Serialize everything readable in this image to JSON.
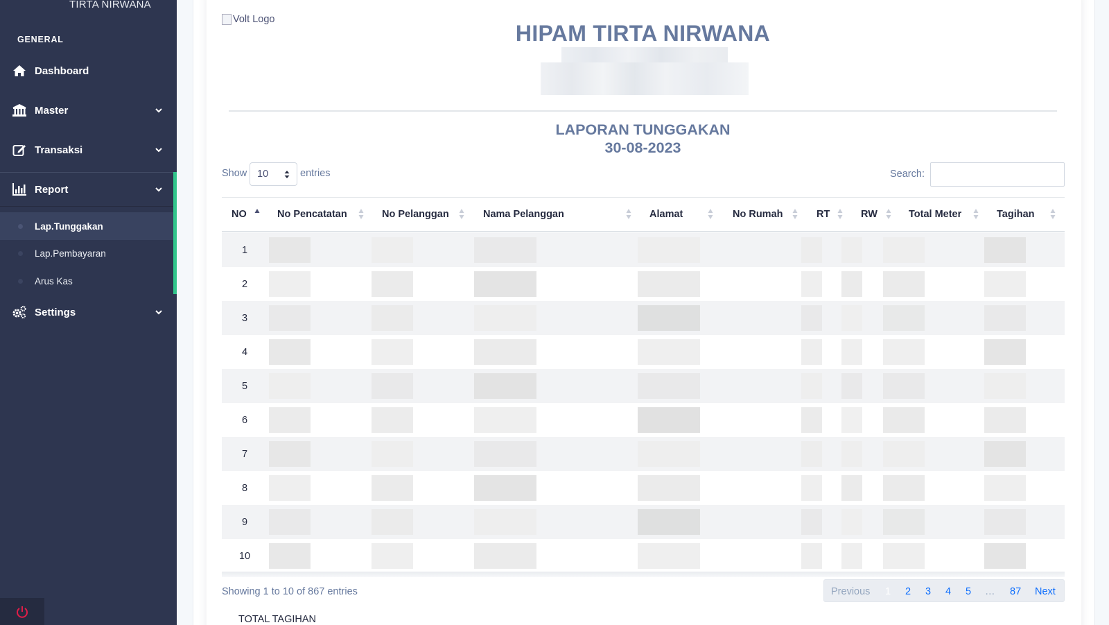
{
  "sidebar": {
    "brand": "TIRTA NIRWANA",
    "section": "GENERAL",
    "items": [
      {
        "label": "Dashboard",
        "icon": "home-icon"
      },
      {
        "label": "Master",
        "icon": "bank-icon"
      },
      {
        "label": "Transaksi",
        "icon": "edit-icon"
      },
      {
        "label": "Report",
        "icon": "chart-icon"
      },
      {
        "label": "Settings",
        "icon": "gears-icon"
      }
    ],
    "report_sub": [
      {
        "label": "Lap.Tunggakan",
        "active": true
      },
      {
        "label": "Lap.Pembayaran",
        "active": false
      },
      {
        "label": "Arus Kas",
        "active": false
      }
    ],
    "accent_color": "#31c58b",
    "power_color": "#e11d48"
  },
  "header": {
    "logo_alt": "Volt Logo",
    "org_title": "HIPAM TIRTA NIRWANA",
    "report_title": "LAPORAN TUNGGAKAN",
    "report_date": "30-08-2023"
  },
  "controls": {
    "show_label": "Show",
    "length_value": "10",
    "entries_label": "entries",
    "search_label": "Search:",
    "search_value": ""
  },
  "table": {
    "columns": [
      "NO",
      "No Pencatatan",
      "No Pelanggan",
      "Nama Pelanggan",
      "Alamat",
      "No Rumah",
      "RT",
      "RW",
      "Total Meter",
      "Tagihan"
    ],
    "sorted_column": "NO",
    "rows": [
      "1",
      "2",
      "3",
      "4",
      "5",
      "6",
      "7",
      "8",
      "9",
      "10"
    ]
  },
  "footer": {
    "info": "Showing 1 to 10 of 867 entries",
    "pager": {
      "previous": "Previous",
      "pages": [
        "1",
        "2",
        "3",
        "4",
        "5"
      ],
      "ellipsis": "…",
      "last": "87",
      "next": "Next",
      "current": "1"
    },
    "total_label": "TOTAL TAGIHAN"
  }
}
